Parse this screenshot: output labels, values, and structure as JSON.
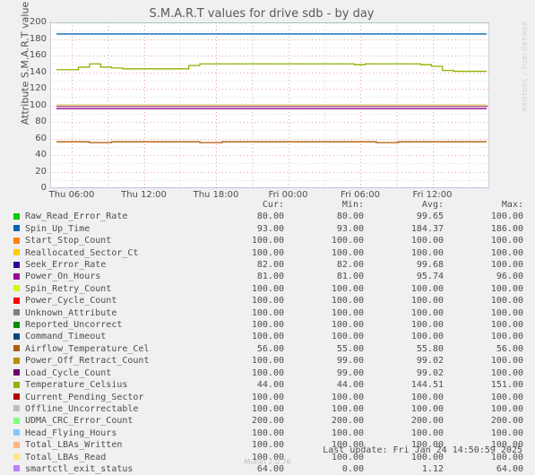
{
  "watermark": "RRDTOOL / TOBI OETIKER",
  "chart_title": "S.M.A.R.T values for drive sdb - by day",
  "y_axis_label": "Attribute S.M.A.R.T value",
  "legend_headers": {
    "cur": "Cur:",
    "min": "Min:",
    "avg": "Avg:",
    "max": "Max:"
  },
  "footer": {
    "last_update": "Last update: Fri Jan 24 14:50:59 2025",
    "munin_version": "Munin 2.0.76"
  },
  "chart_data": {
    "type": "line",
    "title": "S.M.A.R.T values for drive sdb - by day",
    "xlabel": "",
    "ylabel": "Attribute S.M.A.R.T value",
    "ylim": [
      0,
      200
    ],
    "ytick_labels": [
      "200",
      "180",
      "160",
      "140",
      "120",
      "100",
      "80",
      "60",
      "40",
      "20",
      "0"
    ],
    "ytick_values": [
      200,
      180,
      160,
      140,
      120,
      100,
      80,
      60,
      40,
      20,
      0
    ],
    "xtick_labels": [
      "Thu 06:00",
      "Thu 12:00",
      "Thu 18:00",
      "Fri 00:00",
      "Fri 06:00",
      "Fri 12:00"
    ],
    "grid": true,
    "legend_position": "below",
    "series": [
      {
        "name": "Raw_Read_Error_Rate",
        "color": "#00cc00",
        "cur": "80.00",
        "min": "80.00",
        "avg": "99.65",
        "max": "100.00",
        "level": 200,
        "values": [
          200,
          200,
          200,
          200,
          200,
          200,
          200,
          200,
          200,
          200,
          200,
          200,
          200,
          200,
          200,
          200,
          200,
          200,
          200,
          200,
          200,
          200,
          200,
          200,
          200,
          200,
          200,
          200,
          200,
          200,
          200,
          200,
          200,
          200,
          200,
          200,
          200,
          200,
          200,
          200
        ]
      },
      {
        "name": "Spin_Up_Time",
        "color": "#0066b3",
        "cur": "93.00",
        "min": "93.00",
        "avg": "184.37",
        "max": "186.00",
        "level": 186,
        "values": [
          186,
          186,
          186,
          186,
          186,
          186,
          186,
          186,
          186,
          186,
          186,
          186,
          186,
          186,
          186,
          186,
          186,
          186,
          186,
          186,
          186,
          186,
          186,
          186,
          186,
          186,
          186,
          186,
          186,
          186,
          186,
          186,
          186,
          186,
          186,
          186,
          186,
          186,
          186,
          186
        ]
      },
      {
        "name": "Start_Stop_Count",
        "color": "#ff8000",
        "cur": "100.00",
        "min": "100.00",
        "avg": "100.00",
        "max": "100.00",
        "level": 100,
        "values": [
          100,
          100,
          100,
          100,
          100,
          100,
          100,
          100,
          100,
          100,
          100,
          100,
          100,
          100,
          100,
          100,
          100,
          100,
          100,
          100,
          100,
          100,
          100,
          100,
          100,
          100,
          100,
          100,
          100,
          100,
          100,
          100,
          100,
          100,
          100,
          100,
          100,
          100,
          100,
          100
        ]
      },
      {
        "name": "Reallocated_Sector_Ct",
        "color": "#ffcc00",
        "cur": "100.00",
        "min": "100.00",
        "avg": "100.00",
        "max": "100.00",
        "level": 100,
        "values": [
          100,
          100,
          100,
          100,
          100,
          100,
          100,
          100,
          100,
          100,
          100,
          100,
          100,
          100,
          100,
          100,
          100,
          100,
          100,
          100,
          100,
          100,
          100,
          100,
          100,
          100,
          100,
          100,
          100,
          100,
          100,
          100,
          100,
          100,
          100,
          100,
          100,
          100,
          100,
          100
        ]
      },
      {
        "name": "Seek_Error_Rate",
        "color": "#330099",
        "cur": "82.00",
        "min": "82.00",
        "avg": "99.68",
        "max": "100.00",
        "level": 100,
        "values": [
          100,
          100,
          100,
          100,
          100,
          100,
          100,
          100,
          100,
          100,
          100,
          100,
          100,
          100,
          100,
          100,
          100,
          100,
          100,
          100,
          100,
          100,
          100,
          100,
          100,
          100,
          100,
          100,
          100,
          100,
          100,
          100,
          100,
          100,
          100,
          100,
          100,
          100,
          100,
          100
        ]
      },
      {
        "name": "Power_On_Hours",
        "color": "#990099",
        "cur": "81.00",
        "min": "81.00",
        "avg": "95.74",
        "max": "96.00",
        "level": 96,
        "values": [
          96,
          96,
          96,
          96,
          96,
          96,
          96,
          96,
          96,
          96,
          96,
          96,
          96,
          96,
          96,
          96,
          96,
          96,
          96,
          96,
          96,
          96,
          96,
          96,
          96,
          96,
          96,
          96,
          96,
          96,
          96,
          96,
          96,
          96,
          96,
          96,
          96,
          96,
          96,
          96
        ]
      },
      {
        "name": "Spin_Retry_Count",
        "color": "#ccff00",
        "cur": "100.00",
        "min": "100.00",
        "avg": "100.00",
        "max": "100.00",
        "level": 100,
        "values": [
          100,
          100,
          100,
          100,
          100,
          100,
          100,
          100,
          100,
          100,
          100,
          100,
          100,
          100,
          100,
          100,
          100,
          100,
          100,
          100,
          100,
          100,
          100,
          100,
          100,
          100,
          100,
          100,
          100,
          100,
          100,
          100,
          100,
          100,
          100,
          100,
          100,
          100,
          100,
          100
        ]
      },
      {
        "name": "Power_Cycle_Count",
        "color": "#ff0000",
        "cur": "100.00",
        "min": "100.00",
        "avg": "100.00",
        "max": "100.00",
        "level": 100,
        "values": [
          100,
          100,
          100,
          100,
          100,
          100,
          100,
          100,
          100,
          100,
          100,
          100,
          100,
          100,
          100,
          100,
          100,
          100,
          100,
          100,
          100,
          100,
          100,
          100,
          100,
          100,
          100,
          100,
          100,
          100,
          100,
          100,
          100,
          100,
          100,
          100,
          100,
          100,
          100,
          100
        ]
      },
      {
        "name": "Unknown_Attribute",
        "color": "#808080",
        "cur": "100.00",
        "min": "100.00",
        "avg": "100.00",
        "max": "100.00",
        "level": 100,
        "values": [
          100,
          100,
          100,
          100,
          100,
          100,
          100,
          100,
          100,
          100,
          100,
          100,
          100,
          100,
          100,
          100,
          100,
          100,
          100,
          100,
          100,
          100,
          100,
          100,
          100,
          100,
          100,
          100,
          100,
          100,
          100,
          100,
          100,
          100,
          100,
          100,
          100,
          100,
          100,
          100
        ]
      },
      {
        "name": "Reported_Uncorrect",
        "color": "#008f00",
        "cur": "100.00",
        "min": "100.00",
        "avg": "100.00",
        "max": "100.00",
        "level": 100,
        "values": [
          100,
          100,
          100,
          100,
          100,
          100,
          100,
          100,
          100,
          100,
          100,
          100,
          100,
          100,
          100,
          100,
          100,
          100,
          100,
          100,
          100,
          100,
          100,
          100,
          100,
          100,
          100,
          100,
          100,
          100,
          100,
          100,
          100,
          100,
          100,
          100,
          100,
          100,
          100,
          100
        ]
      },
      {
        "name": "Command_Timeout",
        "color": "#00487d",
        "cur": "100.00",
        "min": "100.00",
        "avg": "100.00",
        "max": "100.00",
        "level": 100,
        "values": [
          100,
          100,
          100,
          100,
          100,
          100,
          100,
          100,
          100,
          100,
          100,
          100,
          100,
          100,
          100,
          100,
          100,
          100,
          100,
          100,
          100,
          100,
          100,
          100,
          100,
          100,
          100,
          100,
          100,
          100,
          100,
          100,
          100,
          100,
          100,
          100,
          100,
          100,
          100,
          100
        ]
      },
      {
        "name": "Airflow_Temperature_Cel",
        "color": "#b35a00",
        "cur": "56.00",
        "min": "55.00",
        "avg": "55.80",
        "max": "56.00",
        "level": 56,
        "values": [
          56,
          56,
          56,
          55,
          55,
          56,
          56,
          56,
          56,
          56,
          56,
          56,
          56,
          55,
          55,
          56,
          56,
          56,
          56,
          56,
          56,
          56,
          56,
          56,
          56,
          56,
          56,
          56,
          56,
          55,
          55,
          56,
          56,
          56,
          56,
          56,
          56,
          56,
          56,
          56
        ]
      },
      {
        "name": "Power_Off_Retract_Count",
        "color": "#b38f00",
        "cur": "100.00",
        "min": "99.00",
        "avg": "99.02",
        "max": "100.00",
        "level": 99,
        "values": [
          99,
          99,
          99,
          99,
          99,
          99,
          99,
          99,
          99,
          99,
          99,
          99,
          99,
          99,
          99,
          99,
          99,
          99,
          99,
          99,
          99,
          99,
          99,
          99,
          99,
          99,
          99,
          99,
          99,
          99,
          99,
          99,
          99,
          99,
          99,
          99,
          99,
          99,
          99,
          100
        ]
      },
      {
        "name": "Load_Cycle_Count",
        "color": "#6b006b",
        "cur": "100.00",
        "min": "99.00",
        "avg": "99.02",
        "max": "100.00",
        "level": 99,
        "values": [
          99,
          99,
          99,
          99,
          99,
          99,
          99,
          99,
          99,
          99,
          99,
          99,
          99,
          99,
          99,
          99,
          99,
          99,
          99,
          99,
          99,
          99,
          99,
          99,
          99,
          99,
          99,
          99,
          99,
          99,
          99,
          99,
          99,
          99,
          99,
          99,
          99,
          99,
          99,
          100
        ]
      },
      {
        "name": "Temperature_Celsius",
        "color": "#8fb300",
        "cur": "44.00",
        "min": "44.00",
        "avg": "144.51",
        "max": "151.00",
        "level": 145,
        "values": [
          143,
          143,
          146,
          150,
          146,
          145,
          144,
          144,
          144,
          144,
          144,
          144,
          148,
          150,
          150,
          150,
          150,
          150,
          150,
          150,
          150,
          150,
          150,
          150,
          150,
          150,
          150,
          149,
          150,
          150,
          150,
          150,
          150,
          149,
          147,
          142,
          141,
          141,
          141,
          141
        ]
      },
      {
        "name": "Current_Pending_Sector",
        "color": "#b30000",
        "cur": "100.00",
        "min": "100.00",
        "avg": "100.00",
        "max": "100.00",
        "level": 100,
        "values": [
          100,
          100,
          100,
          100,
          100,
          100,
          100,
          100,
          100,
          100,
          100,
          100,
          100,
          100,
          100,
          100,
          100,
          100,
          100,
          100,
          100,
          100,
          100,
          100,
          100,
          100,
          100,
          100,
          100,
          100,
          100,
          100,
          100,
          100,
          100,
          100,
          100,
          100,
          100,
          100
        ]
      },
      {
        "name": "Offline_Uncorrectable",
        "color": "#bebebe",
        "cur": "100.00",
        "min": "100.00",
        "avg": "100.00",
        "max": "100.00",
        "level": 100,
        "values": [
          100,
          100,
          100,
          100,
          100,
          100,
          100,
          100,
          100,
          100,
          100,
          100,
          100,
          100,
          100,
          100,
          100,
          100,
          100,
          100,
          100,
          100,
          100,
          100,
          100,
          100,
          100,
          100,
          100,
          100,
          100,
          100,
          100,
          100,
          100,
          100,
          100,
          100,
          100,
          100
        ]
      },
      {
        "name": "UDMA_CRC_Error_Count",
        "color": "#80ff80",
        "cur": "200.00",
        "min": "200.00",
        "avg": "200.00",
        "max": "200.00",
        "level": 200,
        "values": [
          200,
          200,
          200,
          200,
          200,
          200,
          200,
          200,
          200,
          200,
          200,
          200,
          200,
          200,
          200,
          200,
          200,
          200,
          200,
          200,
          200,
          200,
          200,
          200,
          200,
          200,
          200,
          200,
          200,
          200,
          200,
          200,
          200,
          200,
          200,
          200,
          200,
          200,
          200,
          200
        ]
      },
      {
        "name": "Head_Flying_Hours",
        "color": "#80c9ff",
        "cur": "100.00",
        "min": "100.00",
        "avg": "100.00",
        "max": "100.00",
        "level": 100,
        "values": [
          100,
          100,
          100,
          100,
          100,
          100,
          100,
          100,
          100,
          100,
          100,
          100,
          100,
          100,
          100,
          100,
          100,
          100,
          100,
          100,
          100,
          100,
          100,
          100,
          100,
          100,
          100,
          100,
          100,
          100,
          100,
          100,
          100,
          100,
          100,
          100,
          100,
          100,
          100,
          100
        ]
      },
      {
        "name": "Total_LBAs_Written",
        "color": "#ffb380",
        "cur": "100.00",
        "min": "100.00",
        "avg": "100.00",
        "max": "100.00",
        "level": 100,
        "values": [
          100,
          100,
          100,
          100,
          100,
          100,
          100,
          100,
          100,
          100,
          100,
          100,
          100,
          100,
          100,
          100,
          100,
          100,
          100,
          100,
          100,
          100,
          100,
          100,
          100,
          100,
          100,
          100,
          100,
          100,
          100,
          100,
          100,
          100,
          100,
          100,
          100,
          100,
          100,
          100
        ]
      },
      {
        "name": "Total_LBAs_Read",
        "color": "#ffe680",
        "cur": "100.00",
        "min": "100.00",
        "avg": "100.00",
        "max": "100.00",
        "level": 100,
        "values": [
          100,
          100,
          100,
          100,
          100,
          100,
          100,
          100,
          100,
          100,
          100,
          100,
          100,
          100,
          100,
          100,
          100,
          100,
          100,
          100,
          100,
          100,
          100,
          100,
          100,
          100,
          100,
          100,
          100,
          100,
          100,
          100,
          100,
          100,
          100,
          100,
          100,
          100,
          100,
          100
        ]
      },
      {
        "name": "smartctl_exit_status",
        "color": "#bb80ff",
        "cur": "64.00",
        "min": "0.00",
        "avg": "1.12",
        "max": "64.00",
        "level": 0,
        "values": [
          0,
          0,
          0,
          0,
          0,
          0,
          0,
          0,
          0,
          0,
          0,
          0,
          0,
          0,
          0,
          0,
          0,
          0,
          0,
          0,
          0,
          0,
          0,
          0,
          0,
          0,
          0,
          0,
          0,
          0,
          0,
          0,
          0,
          0,
          0,
          0,
          0,
          0,
          0,
          0
        ]
      }
    ]
  }
}
